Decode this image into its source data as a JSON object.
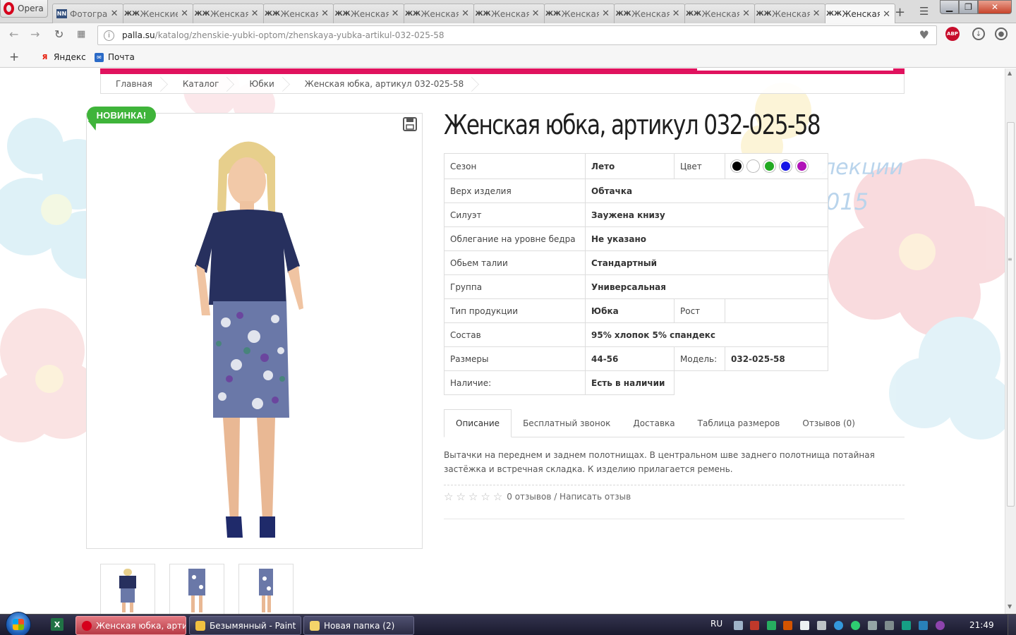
{
  "browser": {
    "menu_label": "Opera",
    "tabs": [
      {
        "title": "Фотогра",
        "icon": "nn-icon",
        "active": false
      },
      {
        "title": "Женские",
        "icon": "palla-icon",
        "active": false
      },
      {
        "title": "Женская",
        "icon": "palla-icon",
        "active": false
      },
      {
        "title": "Женская",
        "icon": "palla-icon",
        "active": false
      },
      {
        "title": "Женская",
        "icon": "palla-icon",
        "active": false
      },
      {
        "title": "Женская",
        "icon": "palla-icon",
        "active": false
      },
      {
        "title": "Женская",
        "icon": "palla-icon",
        "active": false
      },
      {
        "title": "Женская",
        "icon": "palla-icon",
        "active": false
      },
      {
        "title": "Женская",
        "icon": "palla-icon",
        "active": false
      },
      {
        "title": "Женская",
        "icon": "palla-icon",
        "active": false
      },
      {
        "title": "Женская",
        "icon": "palla-icon",
        "active": false
      },
      {
        "title": "Женская",
        "icon": "palla-icon",
        "active": true
      }
    ],
    "url_host": "palla.su",
    "url_path": "/katalog/zhenskie-yubki-optom/zhenskaya-yubka-artikul-032-025-58",
    "abp_label": "ABP",
    "bookmarks": [
      {
        "label": "Яндекс",
        "icon": "yandex-icon"
      },
      {
        "label": "Почта",
        "icon": "mail-icon"
      }
    ]
  },
  "page": {
    "breadcrumb": [
      "Главная",
      "Каталог",
      "Юбки",
      "Женская юбка, артикул 032-025-58"
    ],
    "badge": "НОВИНКА!",
    "background_text": [
      "лекции",
      "015"
    ],
    "title": "Женская юбка, артикул 032-025-58",
    "specs": {
      "season_label": "Сезон",
      "season_value": "Лето",
      "color_label": "Цвет",
      "colors": [
        "#000000",
        "#ffffff",
        "#22aa22",
        "#1515e6",
        "#b013b8"
      ],
      "top_label": "Верх изделия",
      "top_value": "Обтачка",
      "silhouette_label": "Силуэт",
      "silhouette_value": "Заужена книзу",
      "hip_label": "Облегание на уровне бедра",
      "hip_value": "Не указано",
      "waist_label": "Обьем талии",
      "waist_value": "Стандартный",
      "group_label": "Группа",
      "group_value": "Универсальная",
      "type_label": "Тип продукции",
      "type_value": "Юбка",
      "height_label": "Рост",
      "height_value": "",
      "composition_label": "Состав",
      "composition_value": "95% хлопок 5% спандекс",
      "sizes_label": "Размеры",
      "sizes_value": "44-56",
      "model_label": "Модель:",
      "model_value": "032-025-58",
      "availability_label": "Наличие:",
      "availability_value": "Есть в наличии"
    },
    "tabs": [
      "Описание",
      "Бесплатный звонок",
      "Доставка",
      "Таблица размеров",
      "Отзывов (0)"
    ],
    "description": "Вытачки на переднем и заднем полотнищах. В центральном шве заднего полотнища потайная застёжка и встречная складка. К изделию прилагается ремень.",
    "rating_stars": 5,
    "rating_value": 0,
    "reviews_text": "0 отзывов / Написать отзыв"
  },
  "taskbar": {
    "items": [
      {
        "label": "Женская юбка, арти...",
        "active": true,
        "color": "#d6001c"
      },
      {
        "label": "Безымянный - Paint",
        "active": false,
        "color": "#f0c040"
      },
      {
        "label": "Новая папка (2)",
        "active": false,
        "color": "#f4d46a"
      }
    ],
    "lang": "RU",
    "clock": "21:49"
  }
}
